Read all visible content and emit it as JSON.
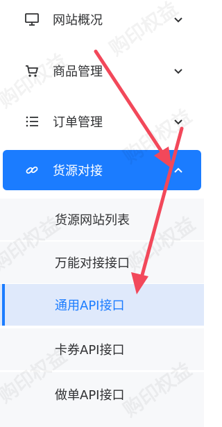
{
  "menu": {
    "items": [
      {
        "label": "网站概况",
        "icon": "monitor-icon",
        "chevron": "chevron-down-icon"
      },
      {
        "label": "商品管理",
        "icon": "cart-icon",
        "chevron": "chevron-down-icon"
      },
      {
        "label": "订单管理",
        "icon": "list-icon",
        "chevron": "chevron-down-icon"
      },
      {
        "label": "货源对接",
        "icon": "link-icon",
        "chevron": "chevron-up-icon"
      }
    ],
    "subitems": [
      {
        "label": "货源网站列表"
      },
      {
        "label": "万能对接接口"
      },
      {
        "label": "通用API接口"
      },
      {
        "label": "卡券API接口"
      },
      {
        "label": "做单API接口"
      }
    ]
  },
  "watermark": "购印权益",
  "colors": {
    "accent": "#1b7cff",
    "arrow": "#f2485a",
    "text": "#303133",
    "submenu_bg": "#f7f8fa",
    "selected_bg": "#dfe9fb"
  }
}
